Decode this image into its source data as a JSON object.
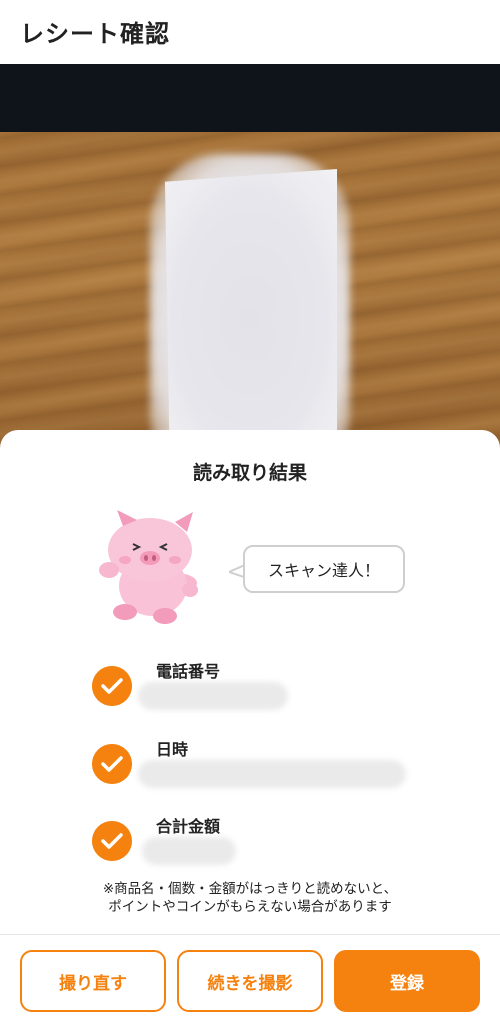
{
  "header": {
    "title": "レシート確認"
  },
  "result": {
    "title": "読み取り結果",
    "mascot_message": "スキャン達人！",
    "items": [
      {
        "label": "電話番号",
        "status": "checked"
      },
      {
        "label": "日時",
        "status": "checked"
      },
      {
        "label": "合計金額",
        "status": "checked"
      }
    ],
    "note_line1": "※商品名・個数・金額がはっきりと読めないと、",
    "note_line2": "ポイントやコインがもらえない場合があります"
  },
  "actions": {
    "retake_label": "撮り直す",
    "continue_label": "続きを撮影",
    "register_label": "登録"
  },
  "colors": {
    "accent": "#f5820f",
    "pig": "#f7b7cf"
  },
  "icons": {
    "check": "check-icon",
    "mascot": "pig-mascot"
  }
}
